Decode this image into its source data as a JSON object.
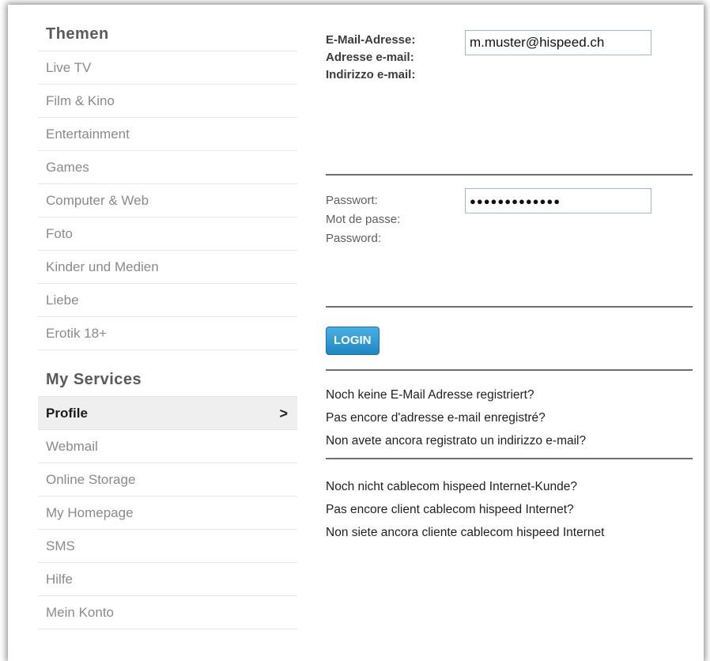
{
  "sidebar": {
    "themen_title": "Themen",
    "themen_items": [
      {
        "label": "Live TV"
      },
      {
        "label": "Film & Kino"
      },
      {
        "label": "Entertainment"
      },
      {
        "label": "Games"
      },
      {
        "label": "Computer & Web"
      },
      {
        "label": "Foto"
      },
      {
        "label": "Kinder und Medien"
      },
      {
        "label": "Liebe"
      },
      {
        "label": "Erotik 18+"
      }
    ],
    "services_title": "My Services",
    "services_items": [
      {
        "label": "Profile",
        "active": true
      },
      {
        "label": "Webmail"
      },
      {
        "label": "Online Storage"
      },
      {
        "label": "My Homepage"
      },
      {
        "label": "SMS"
      },
      {
        "label": "Hilfe"
      },
      {
        "label": "Mein Konto"
      }
    ],
    "active_chevron": ">"
  },
  "login": {
    "email_labels": [
      "E-Mail-Adresse:",
      "Adresse e-mail:",
      "Indirizzo e-mail:"
    ],
    "email_value": "m.muster@hispeed.ch",
    "password_labels": [
      "Passwort:",
      "Mot de passe:",
      "Password:"
    ],
    "password_value": "●●●●●●●●●●●●●",
    "login_button": "LOGIN"
  },
  "links": {
    "register_email": [
      "Noch keine E-Mail Adresse registriert?",
      "Pas encore d'adresse e-mail enregistré?",
      "Non avete ancora registrato un indirizzo e-mail?"
    ],
    "not_customer": [
      "Noch nicht cablecom hispeed Internet-Kunde?",
      "Pas encore client cablecom hispeed Internet?",
      "Non siete ancora cliente cablecom hispeed Internet"
    ]
  },
  "colors": {
    "button_top": "#4ab0e3",
    "button_bottom": "#1f86c2",
    "input_border": "#9db9d3"
  }
}
